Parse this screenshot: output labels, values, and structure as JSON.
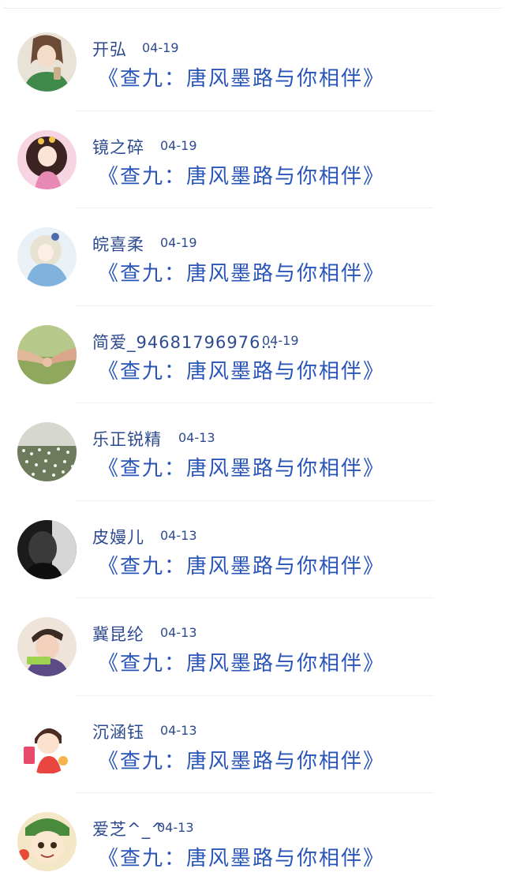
{
  "comments": [
    {
      "name": "开弘",
      "date": "04-19",
      "title": "《查九：唐风墨路与你相伴》",
      "avatar": "woman-with-drink-avatar"
    },
    {
      "name": "镜之碎",
      "date": "04-19",
      "title": "《查九：唐风墨路与你相伴》",
      "avatar": "anime-girl-curly-hair-avatar"
    },
    {
      "name": "皖喜柔",
      "date": "04-19",
      "title": "《查九：唐风墨路与你相伴》",
      "avatar": "anime-girl-blue-dress-avatar"
    },
    {
      "name": "简爱_94681796976…",
      "date": "04-19",
      "title": "《查九：唐风墨路与你相伴》",
      "avatar": "holding-hands-avatar"
    },
    {
      "name": "乐正锐精",
      "date": "04-13",
      "title": "《查九：唐风墨路与你相伴》",
      "avatar": "flower-field-avatar"
    },
    {
      "name": "皮嫚儿",
      "date": "04-13",
      "title": "《查九：唐风墨路与你相伴》",
      "avatar": "dark-portrait-avatar"
    },
    {
      "name": "冀昆纶",
      "date": "04-13",
      "title": "《查九：唐风墨路与你相伴》",
      "avatar": "boy-green-tag-avatar"
    },
    {
      "name": "沉涵钰",
      "date": "04-13",
      "title": "《查九：唐风墨路与你相伴》",
      "avatar": "cartoon-girl-avatar"
    },
    {
      "name": "爱芝^_^",
      "date": "04-13",
      "title": "《查九：唐风墨路与你相伴》",
      "avatar": "cartoon-face-avatar"
    }
  ],
  "colors": {
    "name_text": "#2e4a8f",
    "title_text": "#2a55b8",
    "divider": "#eef0f4"
  }
}
